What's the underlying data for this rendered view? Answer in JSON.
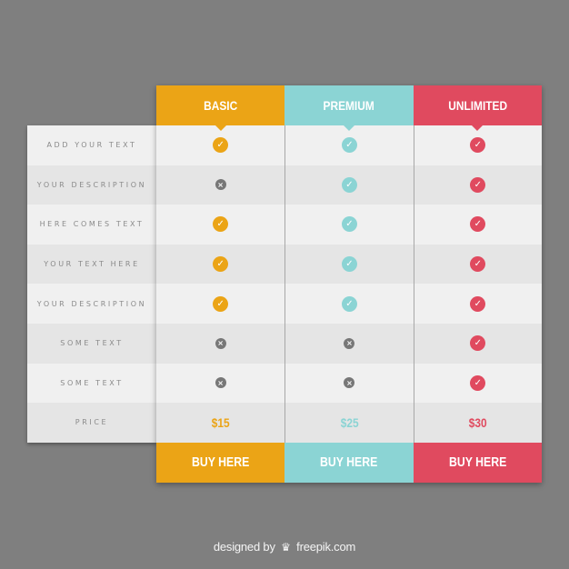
{
  "features": [
    "ADD YOUR TEXT",
    "YOUR DESCRIPTION",
    "HERE COMES TEXT",
    "YOUR TEXT HERE",
    "YOUR DESCRIPTION",
    "SOME TEXT",
    "SOME TEXT",
    "PRICE"
  ],
  "plans": [
    {
      "name": "BASIC",
      "color": "#eba416",
      "included": [
        true,
        false,
        true,
        true,
        true,
        false,
        false
      ],
      "price": "$15",
      "button": "BUY HERE"
    },
    {
      "name": "PREMIUM",
      "color": "#8bd4d4",
      "included": [
        true,
        true,
        true,
        true,
        true,
        false,
        false
      ],
      "price": "$25",
      "button": "BUY HERE"
    },
    {
      "name": "UNLIMITED",
      "color": "#e04a5f",
      "included": [
        true,
        true,
        true,
        true,
        true,
        true,
        true
      ],
      "price": "$30",
      "button": "BUY HERE"
    }
  ],
  "icons": {
    "included": "check-icon",
    "excluded": "cross-icon"
  },
  "credit": {
    "prefix": "designed by",
    "logo": "freepik-logo-icon",
    "site": "freepik.com"
  }
}
